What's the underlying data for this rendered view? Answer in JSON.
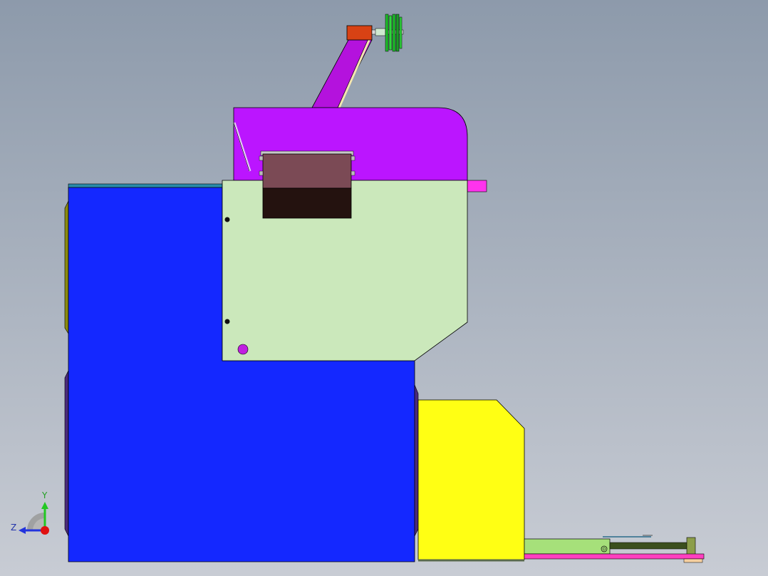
{
  "viewport": {
    "background_top": "#8d9aab",
    "background_bottom": "#c8ccd4"
  },
  "triad": {
    "y_label": "Y",
    "z_label": "Z",
    "y_color": "#22c822",
    "z_color": "#2233dd",
    "x_color": "#e01010"
  },
  "model": {
    "colors": {
      "main_frame": "#1428ff",
      "side_panel": "#cbe8bb",
      "top_housing": "#bb15ff",
      "magenta_arm": "#b412dd",
      "motor": "#d84214",
      "pulley": "#1fba2c",
      "yellow_box": "#ffff14",
      "slide_rail": "#a6e07a",
      "dark_rod": "#3b4f1e",
      "pink_strip": "#ff3fbf",
      "window_top": "#7b4a55",
      "window_bottom": "#24120f",
      "tab": "#ff33ee"
    }
  }
}
